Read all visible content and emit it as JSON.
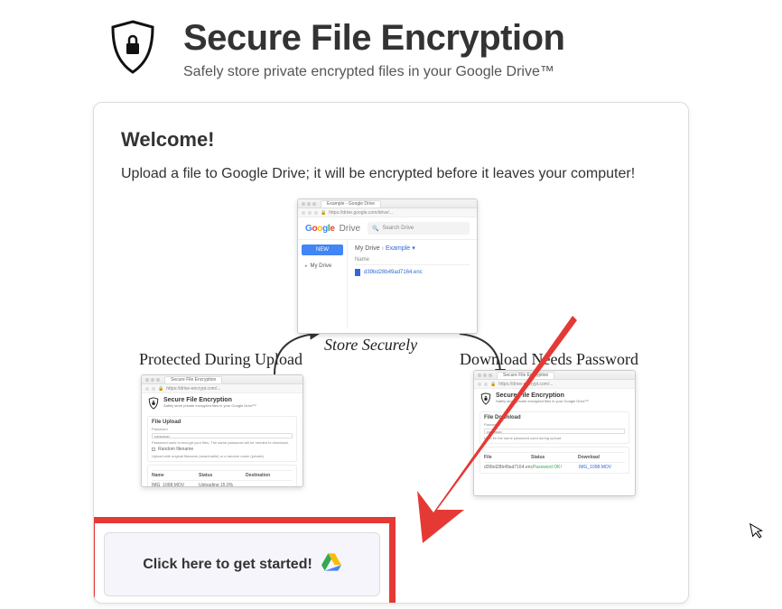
{
  "header": {
    "title": "Secure File Encryption",
    "subtitle": "Safely store private encrypted files in your Google Drive™"
  },
  "card": {
    "welcome_title": "Welcome!",
    "welcome_desc": "Upload a file to Google Drive; it will be encrypted before it leaves your computer!"
  },
  "diagram": {
    "label_store": "Store Securely",
    "label_upload": "Protected During Upload",
    "label_download": "Download Needs Password",
    "drive": {
      "tab": "Example - Google Drive",
      "url": "https://drive.google.com/drive/...",
      "product": "Drive",
      "search_placeholder": "Search Drive",
      "new_button": "NEW",
      "side_item": "My Drive",
      "crumb1": "My Drive",
      "crumb2": "Example",
      "col_name": "Name",
      "file_name": "d39bd28b49ad7164.enc"
    },
    "upload": {
      "tab": "Secure File Encryption",
      "title": "Secure File Encryption",
      "subtitle": "Safely store private encrypted files in your Google Drive™",
      "panel_label": "File Upload",
      "password_label": "Password",
      "hint": "Password used to encrypt your files. The same password will be needed to download.",
      "checkbox_label": "Random filename",
      "hint2": "Upload with original filename (searchable) or a random name (private)",
      "col_name": "Name",
      "col_status": "Status",
      "col_dest": "Destination",
      "row_name": "IMG_1098.MOV",
      "row_status": "Uploading 15.0%"
    },
    "download": {
      "tab": "Secure File Encryption",
      "title": "Secure File Encryption",
      "subtitle": "Safely store private encrypted files in your Google Drive™",
      "panel_label": "File Download",
      "password_label": "Password",
      "hint": "Must be the same password used during upload",
      "col_file": "File",
      "col_status": "Status",
      "col_download": "Download",
      "row_file": "d39bd28b49ad7164.enc",
      "row_status": "Password OK!",
      "row_download": "IMG_1098.MOV"
    }
  },
  "cta": {
    "label": "Click here to get started!"
  }
}
